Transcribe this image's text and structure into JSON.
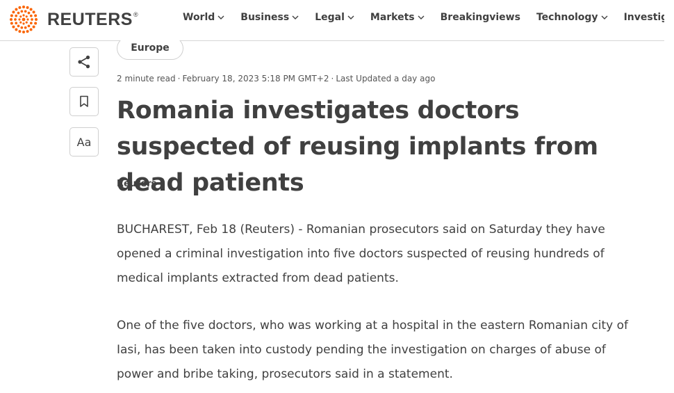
{
  "header": {
    "brand": "REUTERS",
    "brand_mark": "®",
    "brand_color": "#fa6400",
    "nav": [
      {
        "label": "World",
        "dropdown": true
      },
      {
        "label": "Business",
        "dropdown": true
      },
      {
        "label": "Legal",
        "dropdown": true
      },
      {
        "label": "Markets",
        "dropdown": true
      },
      {
        "label": "Breakingviews",
        "dropdown": false
      },
      {
        "label": "Technology",
        "dropdown": true
      },
      {
        "label": "Investigations",
        "dropdown": false
      }
    ]
  },
  "tools": {
    "share_icon": "share-icon",
    "bookmark_icon": "bookmark-icon",
    "font_size_label": "Aa"
  },
  "article": {
    "section_tag": "Europe",
    "meta": {
      "read_time": "2 minute read",
      "published": "February 18, 2023 5:18 PM GMT+2",
      "updated": "Last Updated a day ago"
    },
    "headline": "Romania investigates doctors suspected of reusing implants from dead patients",
    "byline": "Reuters",
    "paragraphs": [
      "BUCHAREST, Feb 18 (Reuters) - Romanian prosecutors said on Saturday they have opened a criminal investigation into five doctors suspected of reusing hundreds of medical implants extracted from dead patients.",
      "One of the five doctors, who was working at a hospital in the eastern Romanian city of Iasi, has been taken into custody pending the investigation on charges of abuse of power and bribe taking, prosecutors said in a statement."
    ]
  }
}
